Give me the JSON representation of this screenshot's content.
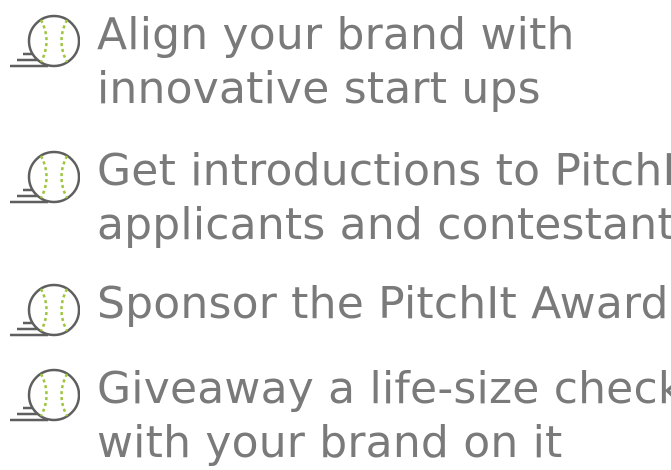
{
  "colors": {
    "text": "#7a7a7a",
    "icon_stroke": "#5f5f5f",
    "seam": "#9bc53d"
  },
  "icon": "baseball-on-steps-icon",
  "items": [
    {
      "line1": "Align your brand with",
      "line2": "innovative start ups"
    },
    {
      "line1": "Get introductions to PitchIt",
      "line2": "applicants and contestants"
    },
    {
      "line1": "Sponsor the PitchIt Award",
      "line2": ""
    },
    {
      "line1": "Giveaway a life-size check",
      "line2": "with your brand on it"
    }
  ]
}
